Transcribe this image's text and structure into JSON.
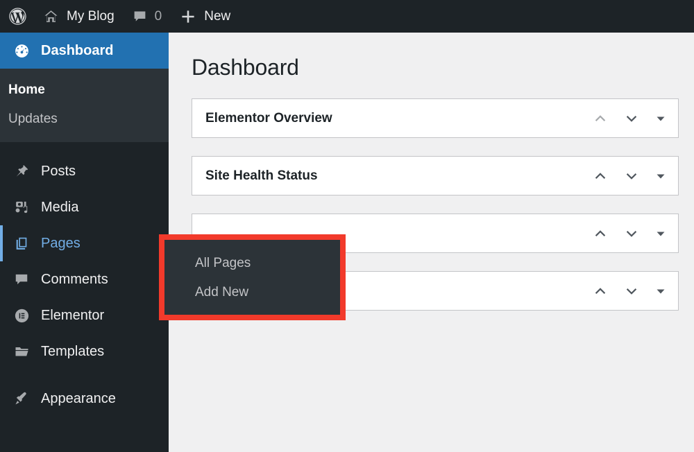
{
  "adminbar": {
    "logo_icon": "wordpress-logo-icon",
    "site_icon": "home-icon",
    "site_name": "My Blog",
    "comments_icon": "comment-bubble-icon",
    "comments_count": "0",
    "new_icon": "plus-icon",
    "new_label": "New"
  },
  "sidebar": {
    "items": [
      {
        "label": "Dashboard",
        "icon": "dashboard-gauge-icon",
        "state": "current"
      },
      {
        "label": "Posts",
        "icon": "pin-icon",
        "state": "default"
      },
      {
        "label": "Media",
        "icon": "media-camera-music-icon",
        "state": "default"
      },
      {
        "label": "Pages",
        "icon": "pages-stacked-icon",
        "state": "hovered"
      },
      {
        "label": "Comments",
        "icon": "comment-bubble-icon",
        "state": "default"
      },
      {
        "label": "Elementor",
        "icon": "elementor-circle-e-icon",
        "state": "default"
      },
      {
        "label": "Templates",
        "icon": "folder-icon",
        "state": "default"
      },
      {
        "label": "Appearance",
        "icon": "paintbrush-icon",
        "state": "default"
      }
    ],
    "dashboard_submenu": [
      {
        "label": "Home",
        "state": "current"
      },
      {
        "label": "Updates",
        "state": "default"
      }
    ]
  },
  "flyout": {
    "parent": "Pages",
    "highlight_color": "#f23a2b",
    "items": [
      {
        "label": "All Pages"
      },
      {
        "label": "Add New"
      }
    ]
  },
  "main": {
    "page_title": "Dashboard",
    "panels": [
      {
        "title": "Elementor Overview",
        "up_icon": "chevron-up-icon",
        "down_icon": "chevron-down-icon",
        "toggle_icon": "triangle-down-icon",
        "up_disabled": true
      },
      {
        "title": "Site Health Status",
        "up_icon": "chevron-up-icon",
        "down_icon": "chevron-down-icon",
        "toggle_icon": "triangle-down-icon",
        "up_disabled": false
      },
      {
        "title": "",
        "up_icon": "chevron-up-icon",
        "down_icon": "chevron-down-icon",
        "toggle_icon": "triangle-down-icon",
        "up_disabled": false
      },
      {
        "title": "",
        "up_icon": "chevron-up-icon",
        "down_icon": "chevron-down-icon",
        "toggle_icon": "triangle-down-icon",
        "up_disabled": false
      }
    ]
  },
  "colors": {
    "admin_blue": "#2271b1",
    "sidebar_dark": "#1d2327",
    "submenu_dark": "#2c3338",
    "hover_blue": "#72aee6",
    "content_bg": "#f0f0f1",
    "annotation_red": "#f23a2b"
  }
}
